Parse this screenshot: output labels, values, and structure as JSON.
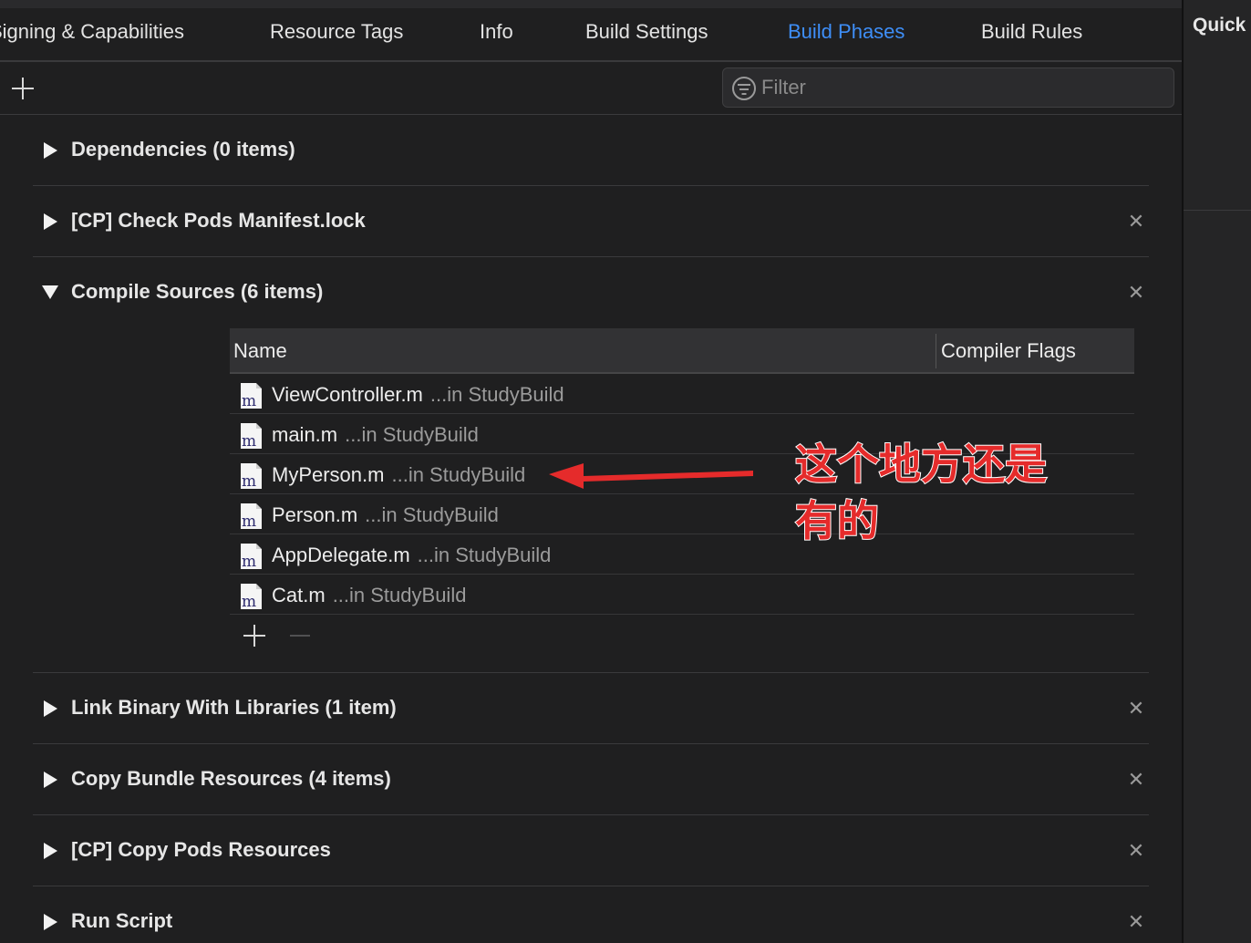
{
  "tabs": [
    {
      "label": "Signing & Capabilities",
      "active": false
    },
    {
      "label": "Resource Tags",
      "active": false
    },
    {
      "label": "Info",
      "active": false
    },
    {
      "label": "Build Settings",
      "active": false
    },
    {
      "label": "Build Phases",
      "active": true
    },
    {
      "label": "Build Rules",
      "active": false
    }
  ],
  "inspector": {
    "title": "Quick Help"
  },
  "toolbar": {
    "filter_placeholder": "Filter",
    "add_icon": "plus-icon",
    "filter_icon": "filter-icon"
  },
  "phases": {
    "dependencies": {
      "title": "Dependencies (0 items)",
      "expanded": false
    },
    "check_pods": {
      "title": "[CP] Check Pods Manifest.lock",
      "expanded": false
    },
    "compile_sources": {
      "title": "Compile Sources (6 items)",
      "expanded": true,
      "columns": {
        "name": "Name",
        "flags": "Compiler Flags"
      },
      "files": [
        {
          "name": "ViewController.m",
          "path": "...in StudyBuild",
          "icon": "m"
        },
        {
          "name": "main.m",
          "path": "...in StudyBuild",
          "icon": "m"
        },
        {
          "name": "MyPerson.m",
          "path": "...in StudyBuild",
          "icon": "m"
        },
        {
          "name": "Person.m",
          "path": "...in StudyBuild",
          "icon": "m"
        },
        {
          "name": "AppDelegate.m",
          "path": "...in StudyBuild",
          "icon": "m"
        },
        {
          "name": "Cat.m",
          "path": "...in StudyBuild",
          "icon": "m"
        }
      ]
    },
    "link_binary": {
      "title": "Link Binary With Libraries (1 item)",
      "expanded": false
    },
    "copy_bundle": {
      "title": "Copy Bundle Resources (4 items)",
      "expanded": false
    },
    "copy_pods": {
      "title": "[CP] Copy Pods Resources",
      "expanded": false
    },
    "run_script": {
      "title": "Run Script",
      "expanded": false
    }
  },
  "close_glyph": "✕",
  "annotation": {
    "line1": "这个地方还是",
    "line2": "有的",
    "color": "#e52b2b"
  },
  "colors": {
    "accent": "#3e8ef7",
    "background": "#1f1f20"
  }
}
